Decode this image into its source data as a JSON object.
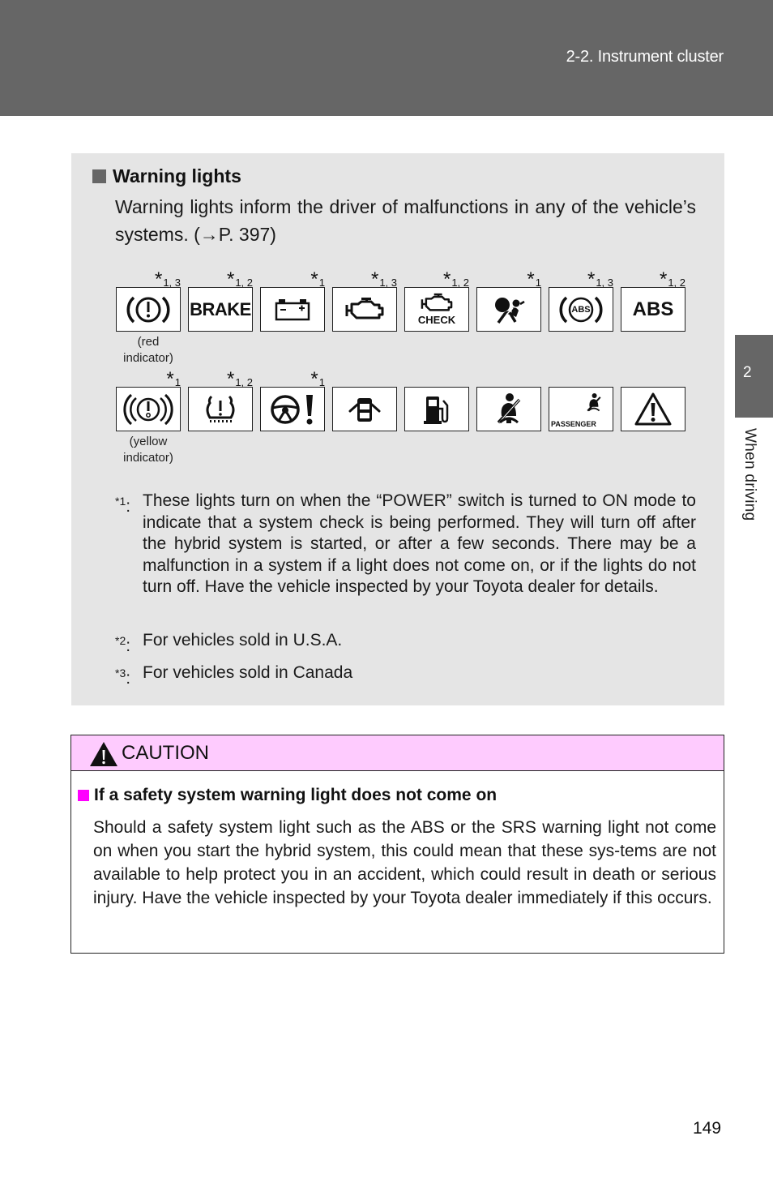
{
  "header": {
    "section_title": "2-2. Instrument cluster"
  },
  "side_tab": {
    "chapter_number": "2",
    "chapter_label": "When driving"
  },
  "warning_lights": {
    "heading": "Warning lights",
    "intro": "Warning lights inform the driver of malfunctions in any of the vehicle’s systems. (→P. 397)",
    "row1": [
      {
        "icon": "brake-warning-circle-icon",
        "note_star": "*",
        "note_sub": "1, 3",
        "caption_line1": "(red",
        "caption_line2": "indicator)"
      },
      {
        "icon": "brake-text-icon",
        "note_star": "*",
        "note_sub": "1, 2",
        "label": "BRAKE"
      },
      {
        "icon": "battery-icon",
        "note_star": "*",
        "note_sub": "1"
      },
      {
        "icon": "engine-icon",
        "note_star": "*",
        "note_sub": "1, 3"
      },
      {
        "icon": "engine-check-icon",
        "note_star": "*",
        "note_sub": "1, 2",
        "label": "CHECK"
      },
      {
        "icon": "airbag-srs-icon",
        "note_star": "*",
        "note_sub": "1"
      },
      {
        "icon": "abs-circle-icon",
        "note_star": "*",
        "note_sub": "1, 3",
        "label": "ABS"
      },
      {
        "icon": "abs-text-icon",
        "note_star": "*",
        "note_sub": "1, 2",
        "label": "ABS"
      }
    ],
    "row2": [
      {
        "icon": "parking-brake-yellow-icon",
        "note_star": "*",
        "note_sub": "1",
        "caption_line1": "(yellow",
        "caption_line2": "indicator)"
      },
      {
        "icon": "tire-pressure-icon",
        "note_star": "*",
        "note_sub": "1, 2"
      },
      {
        "icon": "steering-warning-icon",
        "note_star": "*",
        "note_sub": "1"
      },
      {
        "icon": "door-open-icon"
      },
      {
        "icon": "fuel-pump-icon"
      },
      {
        "icon": "seatbelt-icon"
      },
      {
        "icon": "passenger-seatbelt-icon",
        "label": "PASSENGER"
      },
      {
        "icon": "master-warning-triangle-icon"
      }
    ],
    "footnotes": [
      {
        "mark": "*",
        "num": "1",
        "text": "These lights turn on when the “POWER” switch is turned to ON mode to indicate that a system check is being performed. They will turn off after the hybrid system is started, or after a few seconds. There may be a malfunction in a system if a light does not come on, or if the lights do not turn off. Have the vehicle inspected by your Toyota dealer for details."
      },
      {
        "mark": "*",
        "num": "2",
        "text": "For vehicles sold in U.S.A."
      },
      {
        "mark": "*",
        "num": "3",
        "text": "For vehicles sold in Canada"
      }
    ]
  },
  "caution": {
    "title": "CAUTION",
    "subheading": "If a safety system warning light does not come on",
    "body": "Should a safety system light such as the ABS or the SRS warning light not come on when you start the hybrid system, this could mean that these sys-tems are not available to help protect you in an accident, which could result in death or serious injury. Have the vehicle inspected by your Toyota dealer immediately if this occurs.",
    "colors": {
      "header_bg": "#fecbfe",
      "bullet": "#ff00ff"
    }
  },
  "page_number": "149"
}
